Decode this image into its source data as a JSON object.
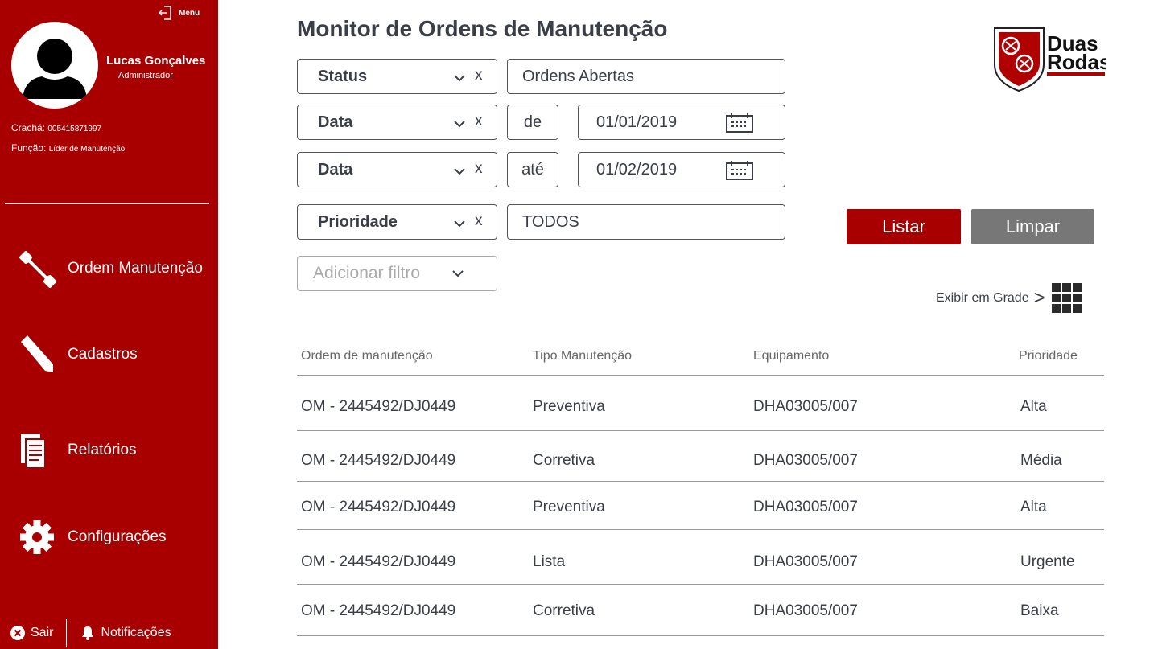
{
  "sidebar": {
    "menu_label": "Menu",
    "user_name": "Lucas Gonçalves",
    "user_role": "Administrador",
    "badge_label": "Crachá:",
    "badge_value": "005415871997",
    "function_label": "Função:",
    "function_value": "Líder de Manutenção",
    "nav": [
      {
        "label": "Ordem Manutenção",
        "icon": "wrench-icon"
      },
      {
        "label": "Cadastros",
        "icon": "pencil-icon"
      },
      {
        "label": "Relatórios",
        "icon": "report-icon"
      },
      {
        "label": "Configurações",
        "icon": "gear-icon"
      }
    ],
    "logout_label": "Sair",
    "notifications_label": "Notificações"
  },
  "header": {
    "title": "Monitor de Ordens de Manutenção",
    "logo_text_top": "Duas",
    "logo_text_bottom": "Rodas"
  },
  "filters": {
    "status": {
      "label": "Status",
      "clear": "x",
      "value": "Ordens Abertas"
    },
    "date_from": {
      "label": "Data",
      "clear": "x",
      "connector": "de",
      "value": "01/01/2019"
    },
    "date_to": {
      "label": "Data",
      "clear": "x",
      "connector": "até",
      "value": "01/02/2019"
    },
    "priority": {
      "label": "Prioridade",
      "clear": "x",
      "value": "TODOS"
    },
    "add_filter_placeholder": "Adicionar filtro"
  },
  "actions": {
    "list_label": "Listar",
    "clear_label": "Limpar",
    "grid_view_label": "Exibir em Grade",
    "grid_view_arrow": ">"
  },
  "table": {
    "headers": [
      "Ordem de manutenção",
      "Tipo Manutenção",
      "Equipamento",
      "Prioridade"
    ],
    "rows": [
      [
        "OM - 2445492/DJ0449",
        "Preventiva",
        "DHA03005/007",
        "Alta"
      ],
      [
        "OM - 2445492/DJ0449",
        "Corretiva",
        "DHA03005/007",
        "Média"
      ],
      [
        "OM - 2445492/DJ0449",
        "Preventiva",
        "DHA03005/007",
        "Alta"
      ],
      [
        "OM - 2445492/DJ0449",
        "Lista",
        "DHA03005/007",
        "Urgente"
      ],
      [
        "OM - 2445492/DJ0449",
        "Corretiva",
        "DHA03005/007",
        "Baixa"
      ]
    ]
  },
  "colors": {
    "brand_red": "#a80000",
    "clear_button": "#777777",
    "text_dark": "#3a3f47"
  }
}
